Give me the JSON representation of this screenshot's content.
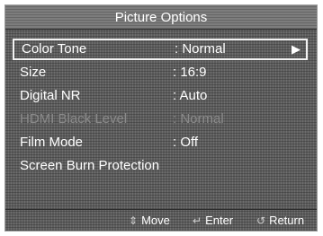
{
  "menu": {
    "title": "Picture Options",
    "items": [
      {
        "label": "Color Tone",
        "value": ": Normal",
        "arrow": "▶"
      },
      {
        "label": "Size",
        "value": ": 16:9"
      },
      {
        "label": "Digital NR",
        "value": ": Auto"
      },
      {
        "label": "HDMI Black Level",
        "value": ": Normal"
      },
      {
        "label": "Film Mode",
        "value": ": Off"
      },
      {
        "label": "Screen Burn Protection",
        "value": ""
      }
    ]
  },
  "footer": {
    "move_icon": "⇕",
    "move_label": "Move",
    "enter_icon": "↵",
    "enter_label": "Enter",
    "return_icon": "↺",
    "return_label": "Return"
  }
}
